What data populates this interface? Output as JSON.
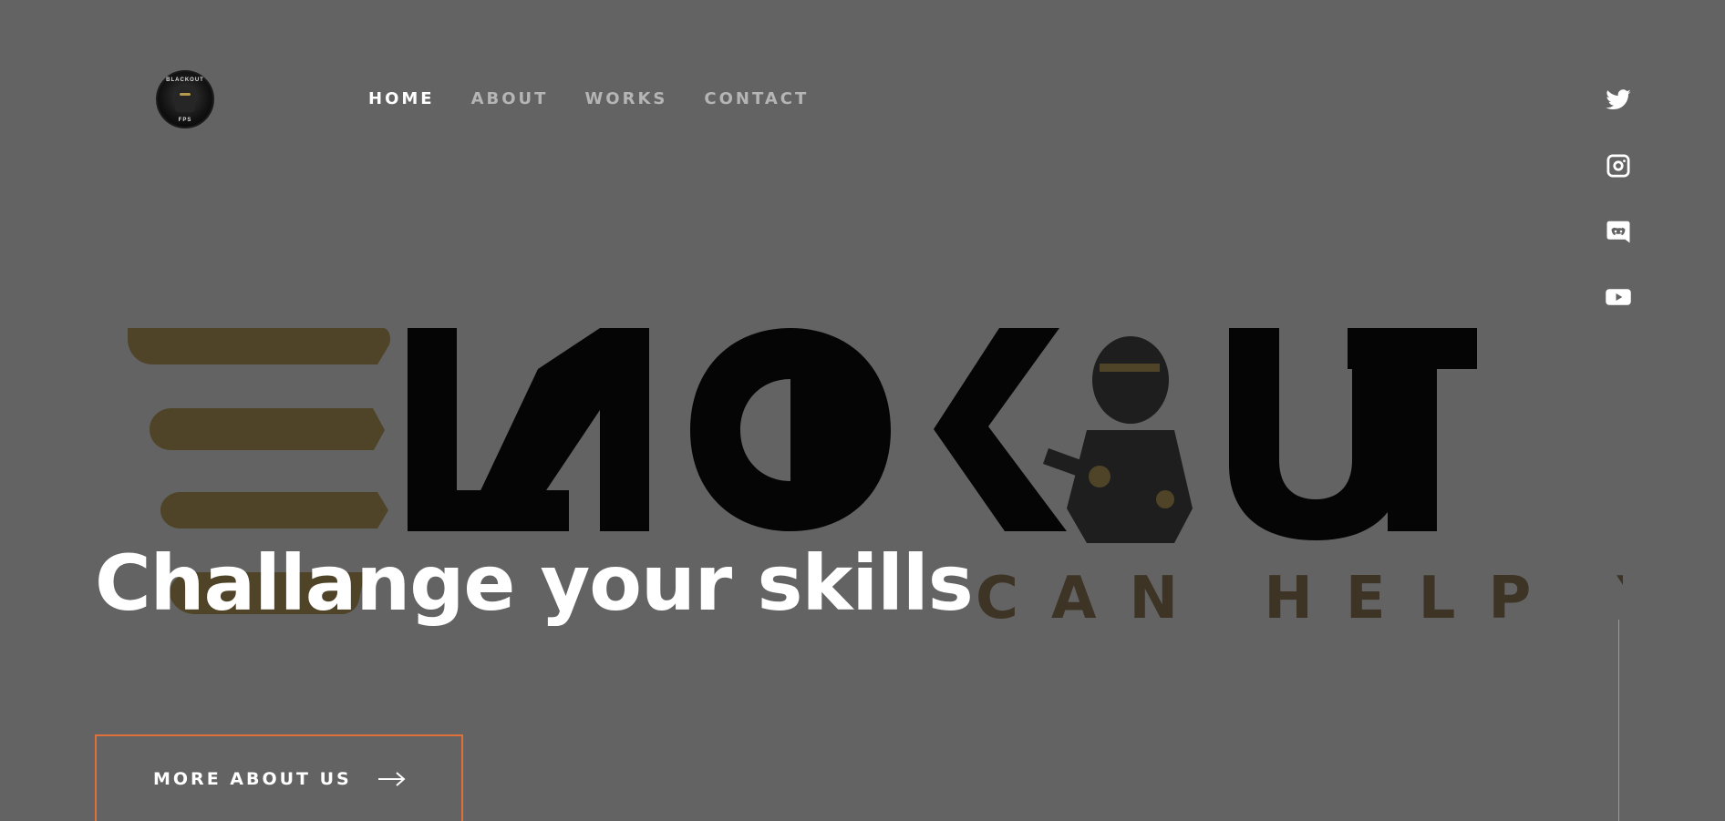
{
  "nav": {
    "items": [
      {
        "label": "HOME",
        "active": true
      },
      {
        "label": "ABOUT",
        "active": false
      },
      {
        "label": "WORKS",
        "active": false
      },
      {
        "label": "CONTACT",
        "active": false
      }
    ]
  },
  "logo": {
    "top_text": "BLACKOUT",
    "bottom_text": "FPS"
  },
  "social": [
    {
      "icon": "twitter-icon"
    },
    {
      "icon": "instagram-icon"
    },
    {
      "icon": "discord-icon"
    },
    {
      "icon": "youtube-icon"
    }
  ],
  "brand": {
    "wordmark": "BLACKOUT",
    "tagline": "CAN HELP YOU"
  },
  "hero": {
    "title": "Challange your skills",
    "cta_label": "MORE ABOUT US"
  },
  "colors": {
    "background": "#636363",
    "accent": "#e06f3a",
    "brand_gold": "#4f4428",
    "text": "#ffffff",
    "nav_inactive": "#b5b5b5"
  }
}
